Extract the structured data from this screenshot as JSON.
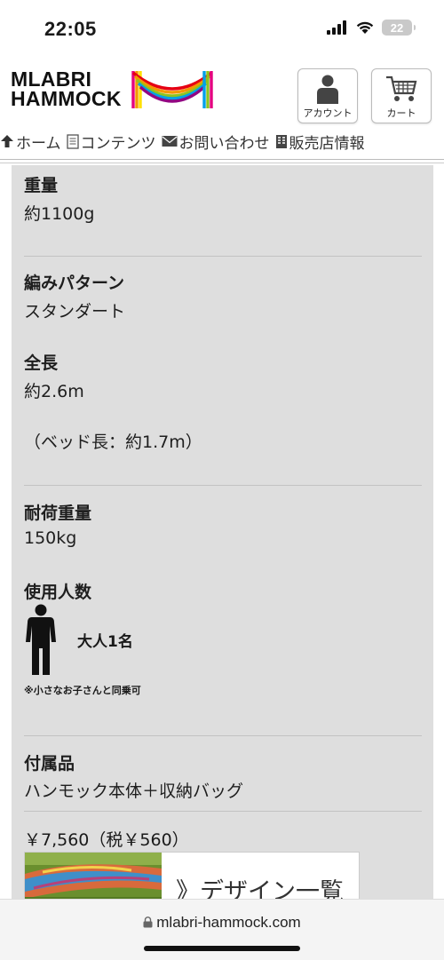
{
  "status": {
    "time": "22:05",
    "battery": "22"
  },
  "brand": {
    "line1": "MLABRI",
    "line2": "HAMMOCK"
  },
  "header": {
    "account_label": "アカウント",
    "cart_label": "カート"
  },
  "nav": [
    {
      "label": "ホーム",
      "icon": "up-arrow-icon"
    },
    {
      "label": "コンテンツ",
      "icon": "document-icon"
    },
    {
      "label": "お問い合わせ",
      "icon": "envelope-icon"
    },
    {
      "label": "販売店情報",
      "icon": "building-icon"
    }
  ],
  "specs": {
    "weight_label": "重量",
    "weight_value": "約1100g",
    "pattern_label": "編みパターン",
    "pattern_value": "スタンダート",
    "length_label": "全長",
    "length_value": "約2.6m",
    "bed_length": "（ベッド長：約1.7m）",
    "load_label": "耐荷重量",
    "load_value": "150kg",
    "users_label": "使用人数",
    "users_value": "大人1名",
    "users_note": "※小さなお子さんと同乗可",
    "accessories_label": "付属品",
    "accessories_value": "ハンモック本体＋収納バッグ"
  },
  "price": "￥7,560（税￥560）",
  "banner": {
    "text": "》デザイン一覧"
  },
  "browser": {
    "url": "mlabri-hammock.com"
  },
  "colors": {
    "panel_bg": "#dedede",
    "divider": "#c2c2c2"
  }
}
